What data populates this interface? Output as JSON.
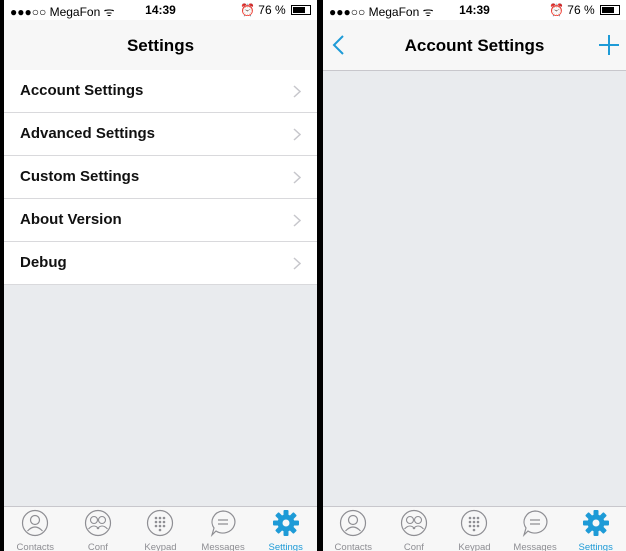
{
  "accent": "#1e9bd7",
  "status": {
    "carrier": "●●●○○ MegaFon ᯤ",
    "time": "14:39",
    "battery": "76 %",
    "battery_level": 0.76,
    "alarm_icon": "alarm-icon"
  },
  "left": {
    "title": "Settings",
    "items": [
      {
        "label": "Account Settings"
      },
      {
        "label": "Advanced Settings"
      },
      {
        "label": "Custom Settings"
      },
      {
        "label": "About Version"
      },
      {
        "label": "Debug"
      }
    ]
  },
  "right": {
    "title": "Account Settings",
    "back_icon": "chevron-left-icon",
    "add_icon": "plus-icon"
  },
  "tabs": [
    {
      "label": "Contacts",
      "icon": "person-icon"
    },
    {
      "label": "Conf",
      "icon": "group-icon"
    },
    {
      "label": "Keypad",
      "icon": "keypad-icon"
    },
    {
      "label": "Messages",
      "icon": "chat-bubble-icon"
    },
    {
      "label": "Settings",
      "icon": "gear-icon",
      "active": true
    }
  ]
}
